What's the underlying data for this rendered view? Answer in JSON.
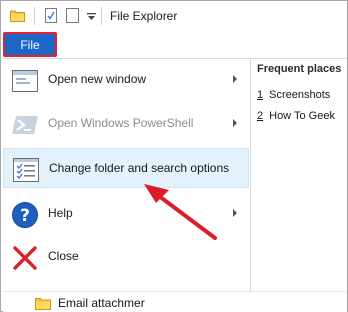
{
  "window": {
    "title": "File Explorer",
    "file_tab_label": "File"
  },
  "menu": {
    "items": [
      {
        "label": "Open new window",
        "icon": "window-icon",
        "has_submenu": true,
        "enabled": true
      },
      {
        "label": "Open Windows PowerShell",
        "icon": "powershell-icon",
        "has_submenu": true,
        "enabled": false
      },
      {
        "label": "Change folder and search options",
        "icon": "options-list-icon",
        "has_submenu": false,
        "enabled": true,
        "hovered": true
      },
      {
        "label": "Help",
        "icon": "help-icon",
        "has_submenu": true,
        "enabled": true
      },
      {
        "label": "Close",
        "icon": "close-icon",
        "has_submenu": false,
        "enabled": true
      }
    ]
  },
  "frequent_places": {
    "header": "Frequent places",
    "items": [
      {
        "num": "1",
        "label": "Screenshots"
      },
      {
        "num": "2",
        "label": "How To Geek"
      }
    ]
  },
  "file_list": {
    "visible_item": "Email attachmer"
  },
  "colors": {
    "file_tab_bg": "#1968c8",
    "highlight_border": "#e8202f",
    "hover_bg": "#e5f1fb",
    "annotation_arrow": "#d91e2a"
  }
}
